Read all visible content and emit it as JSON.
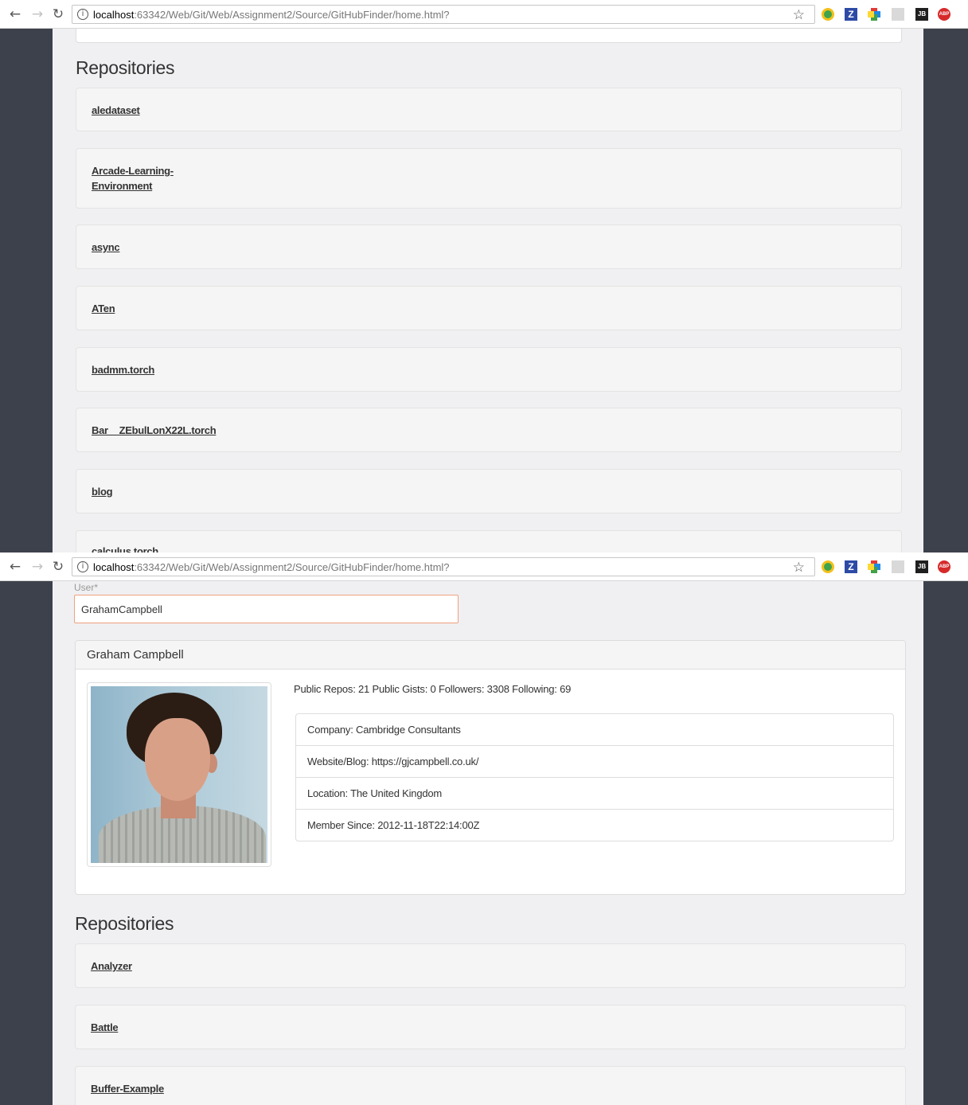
{
  "browser": {
    "url_host": "localhost",
    "url_path": ":63342/Web/Git/Web/Assignment2/Source/GitHubFinder/home.html?",
    "ext_z_label": "Z",
    "ext_jb_label": "JB",
    "ext_abp_label": "ABP"
  },
  "screen1": {
    "section_title": "Repositories",
    "repos": [
      "aledataset",
      "Arcade-Learning-Environment",
      "async",
      "ATen",
      "badmm.torch",
      "Bar__ZEbulLonX22L.torch",
      "blog",
      "calculus.torch"
    ]
  },
  "screen2": {
    "user_label": "User*",
    "user_value": "GrahamCampbell",
    "profile": {
      "name": "Graham Campbell",
      "stats": "Public Repos: 21 Public Gists: 0 Followers: 3308 Following: 69",
      "company": "Company: Cambridge Consultants",
      "website": "Website/Blog: https://gjcampbell.co.uk/",
      "location": "Location: The United Kingdom",
      "member_since": "Member Since: 2012-11-18T22:14:00Z"
    },
    "section_title": "Repositories",
    "repos": [
      "Analyzer",
      "Battle",
      "Buffer-Example"
    ]
  }
}
